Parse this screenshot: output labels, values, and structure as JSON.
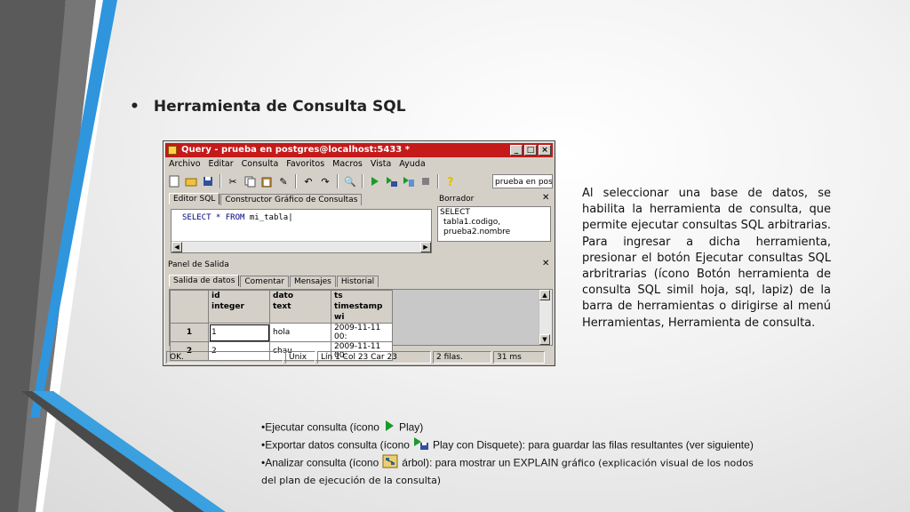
{
  "slide": {
    "title": "Herramienta de Consulta SQL",
    "description": "Al seleccionar una base de datos, se habilita la herramienta de consulta, que permite ejecutar consultas SQL arbitrarias. Para ingresar a dicha herramienta, presionar el botón Ejecutar consultas SQL arbritrarias (ícono Botón herramienta de consulta SQL simil hoja, sql, lapiz) de la barra de herramientas o dirigirse al menú Herramientas, Herramienta de consulta."
  },
  "window": {
    "title": "Query - prueba en postgres@localhost:5433 *",
    "menu": [
      "Archivo",
      "Editar",
      "Consulta",
      "Favoritos",
      "Macros",
      "Vista",
      "Ayuda"
    ],
    "db_select": "prueba en post",
    "editor_tabs": [
      "Editor SQL",
      "Constructor Gráfico de Consultas"
    ],
    "query_keywords": "SELECT * FROM",
    "query_table": "mi_tabla",
    "borrador_title": "Borrador",
    "borrador_lines": [
      "SELECT",
      "tabla1.codigo,",
      "prueba2.nombre"
    ],
    "output_title": "Panel de Salida",
    "output_tabs": [
      "Salida de datos",
      "Comentar",
      "Mensajes",
      "Historial"
    ],
    "columns": [
      {
        "name": "id",
        "type": "integer"
      },
      {
        "name": "dato",
        "type": "text"
      },
      {
        "name": "ts",
        "type": "timestamp wi"
      }
    ],
    "rows": [
      {
        "num": "1",
        "id": "1",
        "dato": "hola",
        "ts": "2009-11-11 00:"
      },
      {
        "num": "2",
        "id": "2",
        "dato": "chau",
        "ts": "2009-11-11 00:"
      }
    ],
    "status": [
      "OK.",
      "Unix",
      "Lín 1 Col 23 Car 23",
      "2 filas.",
      "31 ms"
    ]
  },
  "notes": {
    "n1_pre": "•Ejecutar consulta (ícono",
    "n1_post": "Play)",
    "n2_pre": "•Exportar datos consulta (ícono",
    "n2_post": "Play con Disquete): para guardar las filas resultantes (ver siguiente)",
    "n3_pre": "•Analizar consulta (ícono",
    "n3_mid": "árbol): para mostrar un EXPLAIN",
    "n3_post": "gráfico (explicación visual de los nodos del plan de ejecución de la consulta)"
  },
  "colors": {
    "titlebar": "#c41a1a",
    "accent_blue": "#3aa0e0",
    "accent_gray": "#6b6b6b"
  },
  "icons": [
    "play-icon",
    "play-disk-icon",
    "tree-icon"
  ]
}
